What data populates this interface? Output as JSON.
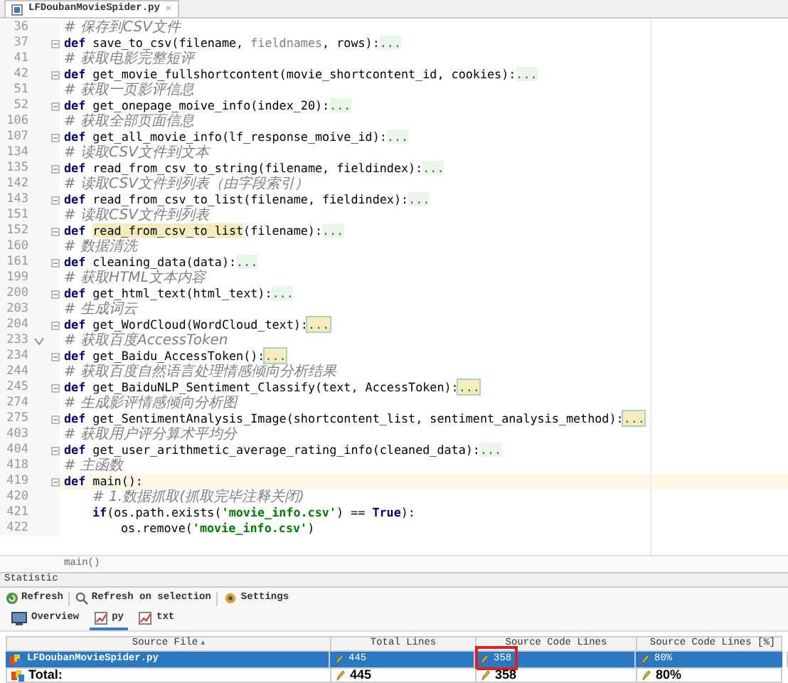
{
  "editor_tab": {
    "label": "LFDoubanMovieSpider.py",
    "close": "×"
  },
  "code_lines": [
    {
      "number": "36",
      "marker": false,
      "current": false,
      "fold": false,
      "tokens": [
        {
          "kind": "comment",
          "text": "# 保存到CSV文件"
        }
      ]
    },
    {
      "number": "37",
      "marker": false,
      "current": false,
      "fold": true,
      "tokens": [
        {
          "kind": "kw",
          "text": "def"
        },
        {
          "kind": "text",
          "text": " save_to_csv(filename, "
        },
        {
          "kind": "unused",
          "text": "fieldnames"
        },
        {
          "kind": "text",
          "text": ", rows):"
        },
        {
          "kind": "fold",
          "text": "..."
        }
      ]
    },
    {
      "number": "41",
      "marker": false,
      "current": false,
      "fold": false,
      "tokens": [
        {
          "kind": "comment",
          "text": "# 获取电影完整短评"
        }
      ]
    },
    {
      "number": "42",
      "marker": false,
      "current": false,
      "fold": true,
      "tokens": [
        {
          "kind": "kw",
          "text": "def"
        },
        {
          "kind": "text",
          "text": " get_movie_fullshortcontent(movie_shortcontent_id, cookies):"
        },
        {
          "kind": "fold",
          "text": "..."
        }
      ]
    },
    {
      "number": "51",
      "marker": false,
      "current": false,
      "fold": false,
      "tokens": [
        {
          "kind": "comment",
          "text": "# 获取一页影评信息"
        }
      ]
    },
    {
      "number": "52",
      "marker": false,
      "current": false,
      "fold": true,
      "tokens": [
        {
          "kind": "kw",
          "text": "def"
        },
        {
          "kind": "text",
          "text": " get_onepage_moive_info(index_20):"
        },
        {
          "kind": "fold",
          "text": "..."
        }
      ]
    },
    {
      "number": "106",
      "marker": false,
      "current": false,
      "fold": false,
      "tokens": [
        {
          "kind": "comment",
          "text": "# 获取全部页面信息"
        }
      ]
    },
    {
      "number": "107",
      "marker": false,
      "current": false,
      "fold": true,
      "tokens": [
        {
          "kind": "kw",
          "text": "def"
        },
        {
          "kind": "text",
          "text": " get_all_movie_info(lf_response_moive_id):"
        },
        {
          "kind": "fold",
          "text": "..."
        }
      ]
    },
    {
      "number": "134",
      "marker": false,
      "current": false,
      "fold": false,
      "tokens": [
        {
          "kind": "comment",
          "text": "# 读取CSV文件到文本"
        }
      ]
    },
    {
      "number": "135",
      "marker": false,
      "current": false,
      "fold": true,
      "tokens": [
        {
          "kind": "kw",
          "text": "def"
        },
        {
          "kind": "text",
          "text": " read_from_csv_to_string(filename, fieldindex):"
        },
        {
          "kind": "fold",
          "text": "..."
        }
      ]
    },
    {
      "number": "142",
      "marker": false,
      "current": false,
      "fold": false,
      "tokens": [
        {
          "kind": "comment",
          "text": "# 读取CSV文件到列表（由字段索引）"
        }
      ]
    },
    {
      "number": "143",
      "marker": false,
      "current": false,
      "fold": true,
      "tokens": [
        {
          "kind": "kw",
          "text": "def"
        },
        {
          "kind": "text",
          "text": " read_from_csv_to_list(filename, fieldindex):"
        },
        {
          "kind": "fold",
          "text": "..."
        }
      ]
    },
    {
      "number": "151",
      "marker": false,
      "current": false,
      "fold": false,
      "tokens": [
        {
          "kind": "comment",
          "text": "# 读取CSV文件到列表"
        }
      ]
    },
    {
      "number": "152",
      "marker": false,
      "current": false,
      "fold": true,
      "tokens": [
        {
          "kind": "kw",
          "text": "def"
        },
        {
          "kind": "match",
          "text": "read_from_csv_to_list"
        },
        {
          "kind": "text",
          "text": "(filename):"
        },
        {
          "kind": "fold",
          "text": "..."
        }
      ]
    },
    {
      "number": "160",
      "marker": false,
      "current": false,
      "fold": false,
      "tokens": [
        {
          "kind": "comment",
          "text": "# 数据清洗"
        }
      ]
    },
    {
      "number": "161",
      "marker": false,
      "current": false,
      "fold": true,
      "tokens": [
        {
          "kind": "kw",
          "text": "def"
        },
        {
          "kind": "text",
          "text": " cleaning_data(data):"
        },
        {
          "kind": "fold",
          "text": "..."
        }
      ]
    },
    {
      "number": "199",
      "marker": false,
      "current": false,
      "fold": false,
      "tokens": [
        {
          "kind": "comment",
          "text": "# 获取HTML文本内容"
        }
      ]
    },
    {
      "number": "200",
      "marker": false,
      "current": false,
      "fold": true,
      "tokens": [
        {
          "kind": "kw",
          "text": "def"
        },
        {
          "kind": "text",
          "text": " get_html_text(html_text):"
        },
        {
          "kind": "fold",
          "text": "..."
        }
      ]
    },
    {
      "number": "203",
      "marker": false,
      "current": false,
      "fold": false,
      "tokens": [
        {
          "kind": "comment",
          "text": "# 生成词云"
        }
      ]
    },
    {
      "number": "204",
      "marker": false,
      "current": false,
      "fold": true,
      "tokens": [
        {
          "kind": "kw",
          "text": "def"
        },
        {
          "kind": "text",
          "text": " get_WordCloud(WordCloud_text):"
        },
        {
          "kind": "warnfold",
          "text": "..."
        }
      ]
    },
    {
      "number": "233",
      "marker": true,
      "current": false,
      "fold": false,
      "tokens": [
        {
          "kind": "comment",
          "text": "# 获取百度AccessToken"
        }
      ]
    },
    {
      "number": "234",
      "marker": false,
      "current": false,
      "fold": true,
      "tokens": [
        {
          "kind": "kw",
          "text": "def"
        },
        {
          "kind": "text",
          "text": " get_Baidu_AccessToken():"
        },
        {
          "kind": "warnfold",
          "text": "..."
        }
      ]
    },
    {
      "number": "244",
      "marker": false,
      "current": false,
      "fold": false,
      "tokens": [
        {
          "kind": "comment",
          "text": "# 获取百度自然语言处理情感倾向分析结果"
        }
      ]
    },
    {
      "number": "245",
      "marker": false,
      "current": false,
      "fold": true,
      "tokens": [
        {
          "kind": "kw",
          "text": "def"
        },
        {
          "kind": "text",
          "text": " get_BaiduNLP_Sentiment_Classify(text, AccessToken):"
        },
        {
          "kind": "warnfold",
          "text": "..."
        }
      ]
    },
    {
      "number": "274",
      "marker": false,
      "current": false,
      "fold": false,
      "tokens": [
        {
          "kind": "comment",
          "text": "# 生成影评情感倾向分析图"
        }
      ]
    },
    {
      "number": "275",
      "marker": false,
      "current": false,
      "fold": true,
      "tokens": [
        {
          "kind": "kw",
          "text": "def"
        },
        {
          "kind": "text",
          "text": " get_SentimentAnalysis_Image(shortcontent_list, sentiment_analysis_method):"
        },
        {
          "kind": "warnfold",
          "text": "..."
        }
      ]
    },
    {
      "number": "403",
      "marker": false,
      "current": false,
      "fold": false,
      "tokens": [
        {
          "kind": "comment",
          "text": "# 获取用户评分算术平均分"
        }
      ]
    },
    {
      "number": "404",
      "marker": false,
      "current": false,
      "fold": true,
      "tokens": [
        {
          "kind": "kw",
          "text": "def"
        },
        {
          "kind": "text",
          "text": " get_user_arithmetic_average_rating_info(cleaned_data):"
        },
        {
          "kind": "fold",
          "text": "..."
        }
      ]
    },
    {
      "number": "418",
      "marker": false,
      "current": false,
      "fold": false,
      "tokens": [
        {
          "kind": "comment",
          "text": "# 主函数"
        }
      ]
    },
    {
      "number": "419",
      "marker": false,
      "current": true,
      "fold": true,
      "tokens": [
        {
          "kind": "kw",
          "text": "def"
        },
        {
          "kind": "text",
          "text": " main():"
        }
      ],
      "children": [
        {
          "number": "420",
          "marker": false,
          "current": false,
          "fold": false,
          "tokens": [
            {
              "kind": "comment",
              "text": "# 1.数据抓取(抓取完毕注释关闭)"
            }
          ]
        },
        {
          "number": "421",
          "marker": false,
          "current": false,
          "fold": false,
          "tokens": [
            {
              "kind": "kw",
              "text": "if"
            },
            {
              "kind": "text",
              "text": "(os.path.exists("
            },
            {
              "kind": "string",
              "text": "'movie_info.csv'"
            },
            {
              "kind": "text",
              "text": ") == "
            },
            {
              "kind": "kw",
              "text": "True"
            },
            {
              "kind": "text",
              "text": "):"
            }
          ],
          "children": [
            {
              "number": "422",
              "marker": false,
              "current": false,
              "fold": false,
              "tokens": [
                {
                  "kind": "text",
                  "text": "os.remove("
                },
                {
                  "kind": "string",
                  "text": "'movie_info.csv'"
                },
                {
                  "kind": "text",
                  "text": ")"
                }
              ]
            }
          ]
        }
      ]
    }
  ],
  "breadcrumb": "main()",
  "panel": {
    "title": "Statistic",
    "toolbar": [
      {
        "kind": "refresh",
        "label": "Refresh"
      },
      {
        "kind": "search",
        "label": "Refresh on selection"
      },
      {
        "kind": "settings",
        "label": "Settings"
      }
    ],
    "tabs": [
      {
        "kind": "overview",
        "label": "Overview",
        "selected": false
      },
      {
        "kind": "chart",
        "label": "py",
        "selected": true
      },
      {
        "kind": "chart",
        "label": "txt",
        "selected": false
      }
    ],
    "table": {
      "columns": [
        {
          "label": "Source File",
          "sort": "▲"
        },
        {
          "label": "Total Lines"
        },
        {
          "label": "Source Code Lines"
        },
        {
          "label": "Source Code Lines [%]"
        }
      ],
      "rows": [
        {
          "selected": true,
          "total": false,
          "cells": [
            {
              "text": "LFDoubanMovieSpider.py",
              "boxed": false
            },
            {
              "text": "445",
              "boxed": false
            },
            {
              "text": "358",
              "boxed": true
            },
            {
              "text": "80%",
              "boxed": false
            }
          ]
        },
        {
          "selected": false,
          "total": true,
          "cells": [
            {
              "text": "Total:",
              "boxed": false
            },
            {
              "text": "445",
              "boxed": false
            },
            {
              "text": "358",
              "boxed": false
            },
            {
              "text": "80%",
              "boxed": false
            }
          ]
        }
      ]
    }
  }
}
